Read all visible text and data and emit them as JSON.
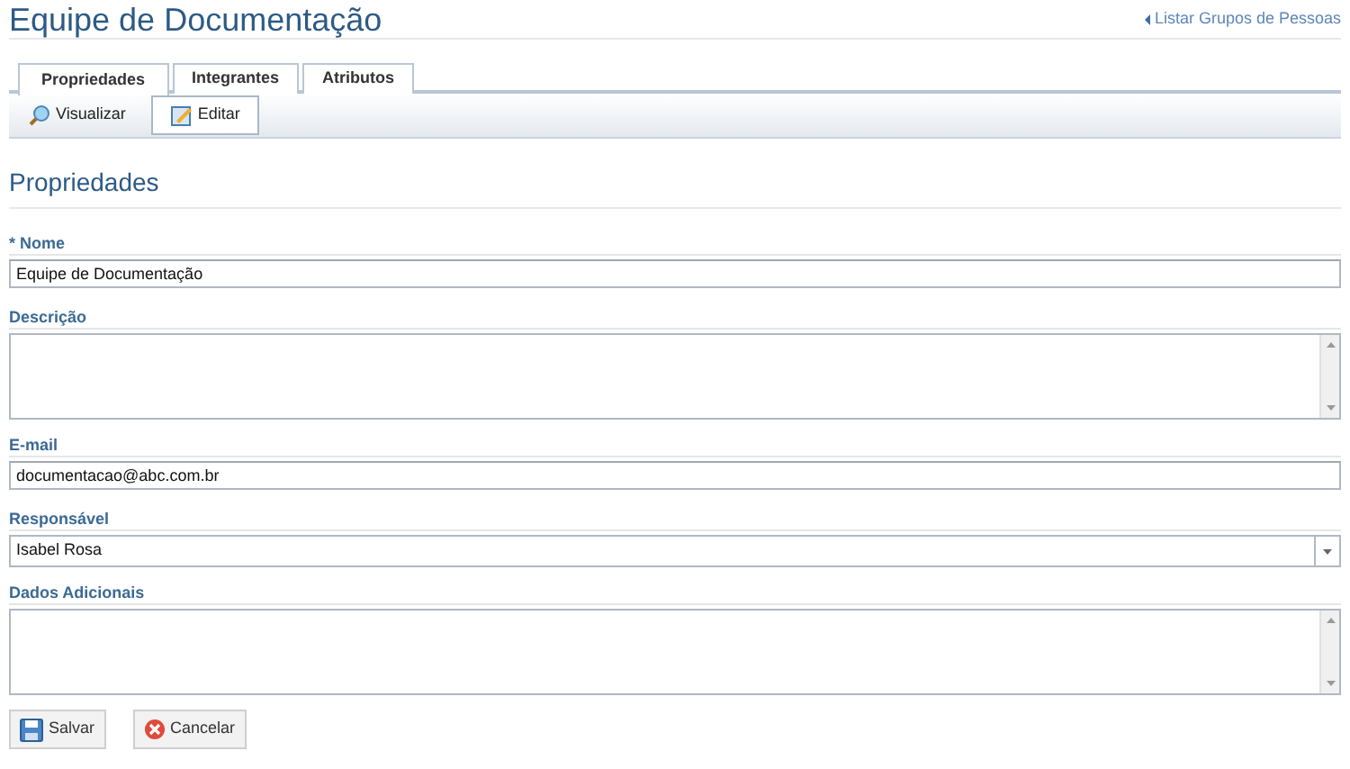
{
  "page": {
    "title": "Equipe de Documentação",
    "back_link": "Listar Grupos de Pessoas"
  },
  "tabs": [
    {
      "label": "Propriedades",
      "selected": true
    },
    {
      "label": "Integrantes",
      "selected": false
    },
    {
      "label": "Atributos",
      "selected": false
    }
  ],
  "toolbar": [
    {
      "label": "Visualizar",
      "kind": "view",
      "selected": false
    },
    {
      "label": "Editar",
      "kind": "edit",
      "selected": true
    }
  ],
  "section_title": "Propriedades",
  "fields": [
    {
      "label": "* Nome",
      "kind": "text",
      "value": "Equipe de Documentação"
    },
    {
      "label": "Descrição",
      "kind": "textarea"
    },
    {
      "label": "E-mail",
      "kind": "text",
      "value": "documentacao@abc.com.br"
    },
    {
      "label": "Responsável",
      "kind": "select",
      "value": "Isabel Rosa"
    },
    {
      "label": "Dados Adicionais",
      "kind": "textarea"
    }
  ],
  "buttons": [
    {
      "label": "Salvar",
      "kind": "save"
    },
    {
      "label": "Cancelar",
      "kind": "cancel"
    }
  ]
}
